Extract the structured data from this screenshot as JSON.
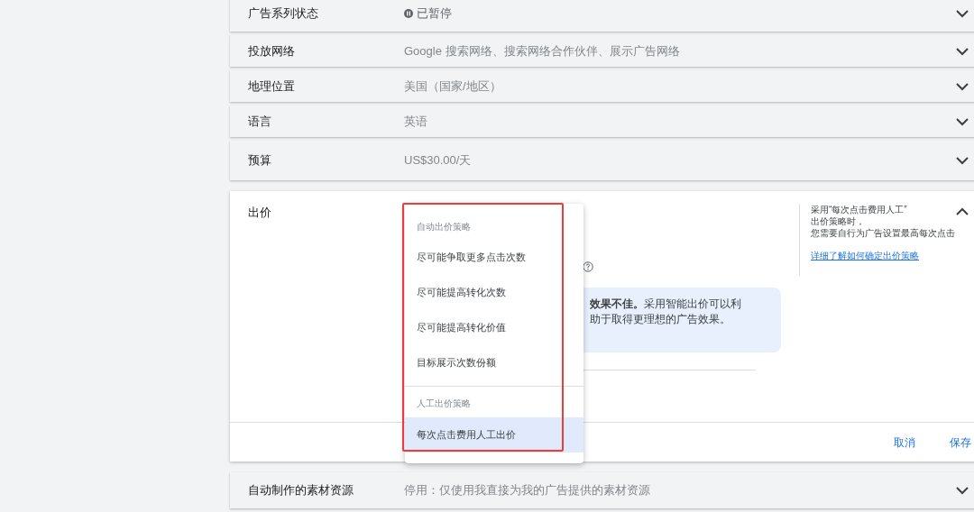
{
  "settings": [
    {
      "label": "广告系列状态",
      "value": "已暂停",
      "kind": "status",
      "expanded": false
    },
    {
      "label": "投放网络",
      "value": "Google 搜索网络、搜索网络合作伙伴、展示广告网络",
      "expanded": false
    },
    {
      "label": "地理位置",
      "value": "美国（国家/地区）",
      "expanded": false
    },
    {
      "label": "语言",
      "value": "英语",
      "expanded": false
    },
    {
      "label": "预算",
      "value": "US$30.00/天",
      "expanded": false
    }
  ],
  "bidding": {
    "label": "出价",
    "expanded": true,
    "info_text": [
      "**效果不佳。**采用智能出价可以利",
      "助于取得更理想的广告效果。"
    ],
    "side_note": [
      "采用“每次点击费用人工”",
      "出价策略时，",
      "您需要自行为广告设置最高每次点击"
    ],
    "link": "详细了解如何确定出价策略",
    "buttons": [
      "取消",
      "保存"
    ],
    "dropdown": {
      "groups": [
        {
          "heading": "自动出价策略",
          "options": [
            {
              "label": "尽可能争取更多点击次数",
              "selected": false
            },
            {
              "label": "尽可能提高转化次数",
              "selected": false
            },
            {
              "label": "尽可能提高转化价值",
              "selected": false
            },
            {
              "label": "目标展示次数份额",
              "selected": false
            }
          ]
        },
        {
          "heading": "人工出价策略",
          "options": [
            {
              "label": "每次点击费用人工出价",
              "selected": true
            }
          ]
        }
      ]
    }
  },
  "more_settings": [
    {
      "label": "自动制作的素材资源",
      "value": "停用：仅使用我直接为我的广告提供的素材资源",
      "expanded": false
    }
  ]
}
